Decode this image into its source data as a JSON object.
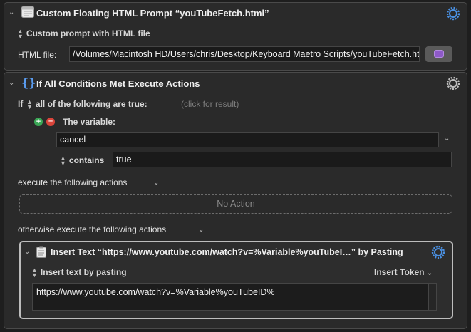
{
  "action1": {
    "title": "Custom Floating HTML Prompt “youTubeFetch.html”",
    "mode": "Custom prompt with HTML file",
    "file_label": "HTML file:",
    "file_value": "/Volumes/Macintosh HD/Users/chris/Desktop/Keyboard Maetro Scripts/youTubeFetch.html"
  },
  "action2": {
    "title": "If All Conditions Met Execute Actions",
    "if_label": "If",
    "condition_mode": "all of the following are true:",
    "result_hint": "(click for result)",
    "condition": {
      "type_label": "The variable:",
      "variable": "cancel",
      "operator": "contains",
      "value": "true"
    },
    "then_label": "execute the following actions",
    "no_action": "No Action",
    "else_label": "otherwise execute the following actions"
  },
  "action3": {
    "title": "Insert Text “https://www.youtube.com/watch?v=%Variable%youTubeI…” by Pasting",
    "mode": "Insert text by pasting",
    "token_label": "Insert Token",
    "text": "https://www.youtube.com/watch?v=%Variable%youTubeID%"
  },
  "colors": {
    "accent_purple": "#8e5ac8",
    "gear_blue": "#4a90e2",
    "add_green": "#3aa655",
    "remove_red": "#d9443a"
  }
}
